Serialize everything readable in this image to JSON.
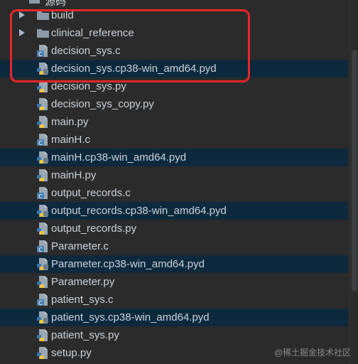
{
  "header": {
    "label": "源码"
  },
  "items": [
    {
      "label": "build",
      "type": "folder",
      "expandable": true,
      "highlight": false
    },
    {
      "label": "clinical_reference",
      "type": "folder",
      "expandable": true,
      "highlight": false
    },
    {
      "label": "decision_sys.c",
      "type": "c",
      "expandable": false,
      "highlight": false
    },
    {
      "label": "decision_sys.cp38-win_amd64.pyd",
      "type": "pyd",
      "expandable": false,
      "highlight": true
    },
    {
      "label": "decision_sys.py",
      "type": "py",
      "expandable": false,
      "highlight": false
    },
    {
      "label": "decision_sys_copy.py",
      "type": "py",
      "expandable": false,
      "highlight": false
    },
    {
      "label": "main.py",
      "type": "py",
      "expandable": false,
      "highlight": false
    },
    {
      "label": "mainH.c",
      "type": "c",
      "expandable": false,
      "highlight": false
    },
    {
      "label": "mainH.cp38-win_amd64.pyd",
      "type": "pyd",
      "expandable": false,
      "highlight": true
    },
    {
      "label": "mainH.py",
      "type": "py",
      "expandable": false,
      "highlight": false
    },
    {
      "label": "output_records.c",
      "type": "c",
      "expandable": false,
      "highlight": false
    },
    {
      "label": "output_records.cp38-win_amd64.pyd",
      "type": "pyd",
      "expandable": false,
      "highlight": true
    },
    {
      "label": "output_records.py",
      "type": "py",
      "expandable": false,
      "highlight": false
    },
    {
      "label": "Parameter.c",
      "type": "c",
      "expandable": false,
      "highlight": false
    },
    {
      "label": "Parameter.cp38-win_amd64.pyd",
      "type": "pyd",
      "expandable": false,
      "highlight": true
    },
    {
      "label": "Parameter.py",
      "type": "py",
      "expandable": false,
      "highlight": false
    },
    {
      "label": "patient_sys.c",
      "type": "c",
      "expandable": false,
      "highlight": false
    },
    {
      "label": "patient_sys.cp38-win_amd64.pyd",
      "type": "pyd",
      "expandable": false,
      "highlight": true
    },
    {
      "label": "patient_sys.py",
      "type": "py",
      "expandable": false,
      "highlight": false
    },
    {
      "label": "setup.py",
      "type": "py",
      "expandable": false,
      "highlight": false
    }
  ],
  "icons": {
    "folder": "folder-icon",
    "c": "c-file-icon",
    "py": "python-file-icon",
    "pyd": "pyd-file-icon",
    "arrow": "chevron-right-icon"
  },
  "colors": {
    "background": "#2b2b2b",
    "row_highlight": "#0d293e",
    "text": "#cdd3d9",
    "annotation": "#e8272a"
  },
  "watermark": "@稀土掘金技术社区"
}
